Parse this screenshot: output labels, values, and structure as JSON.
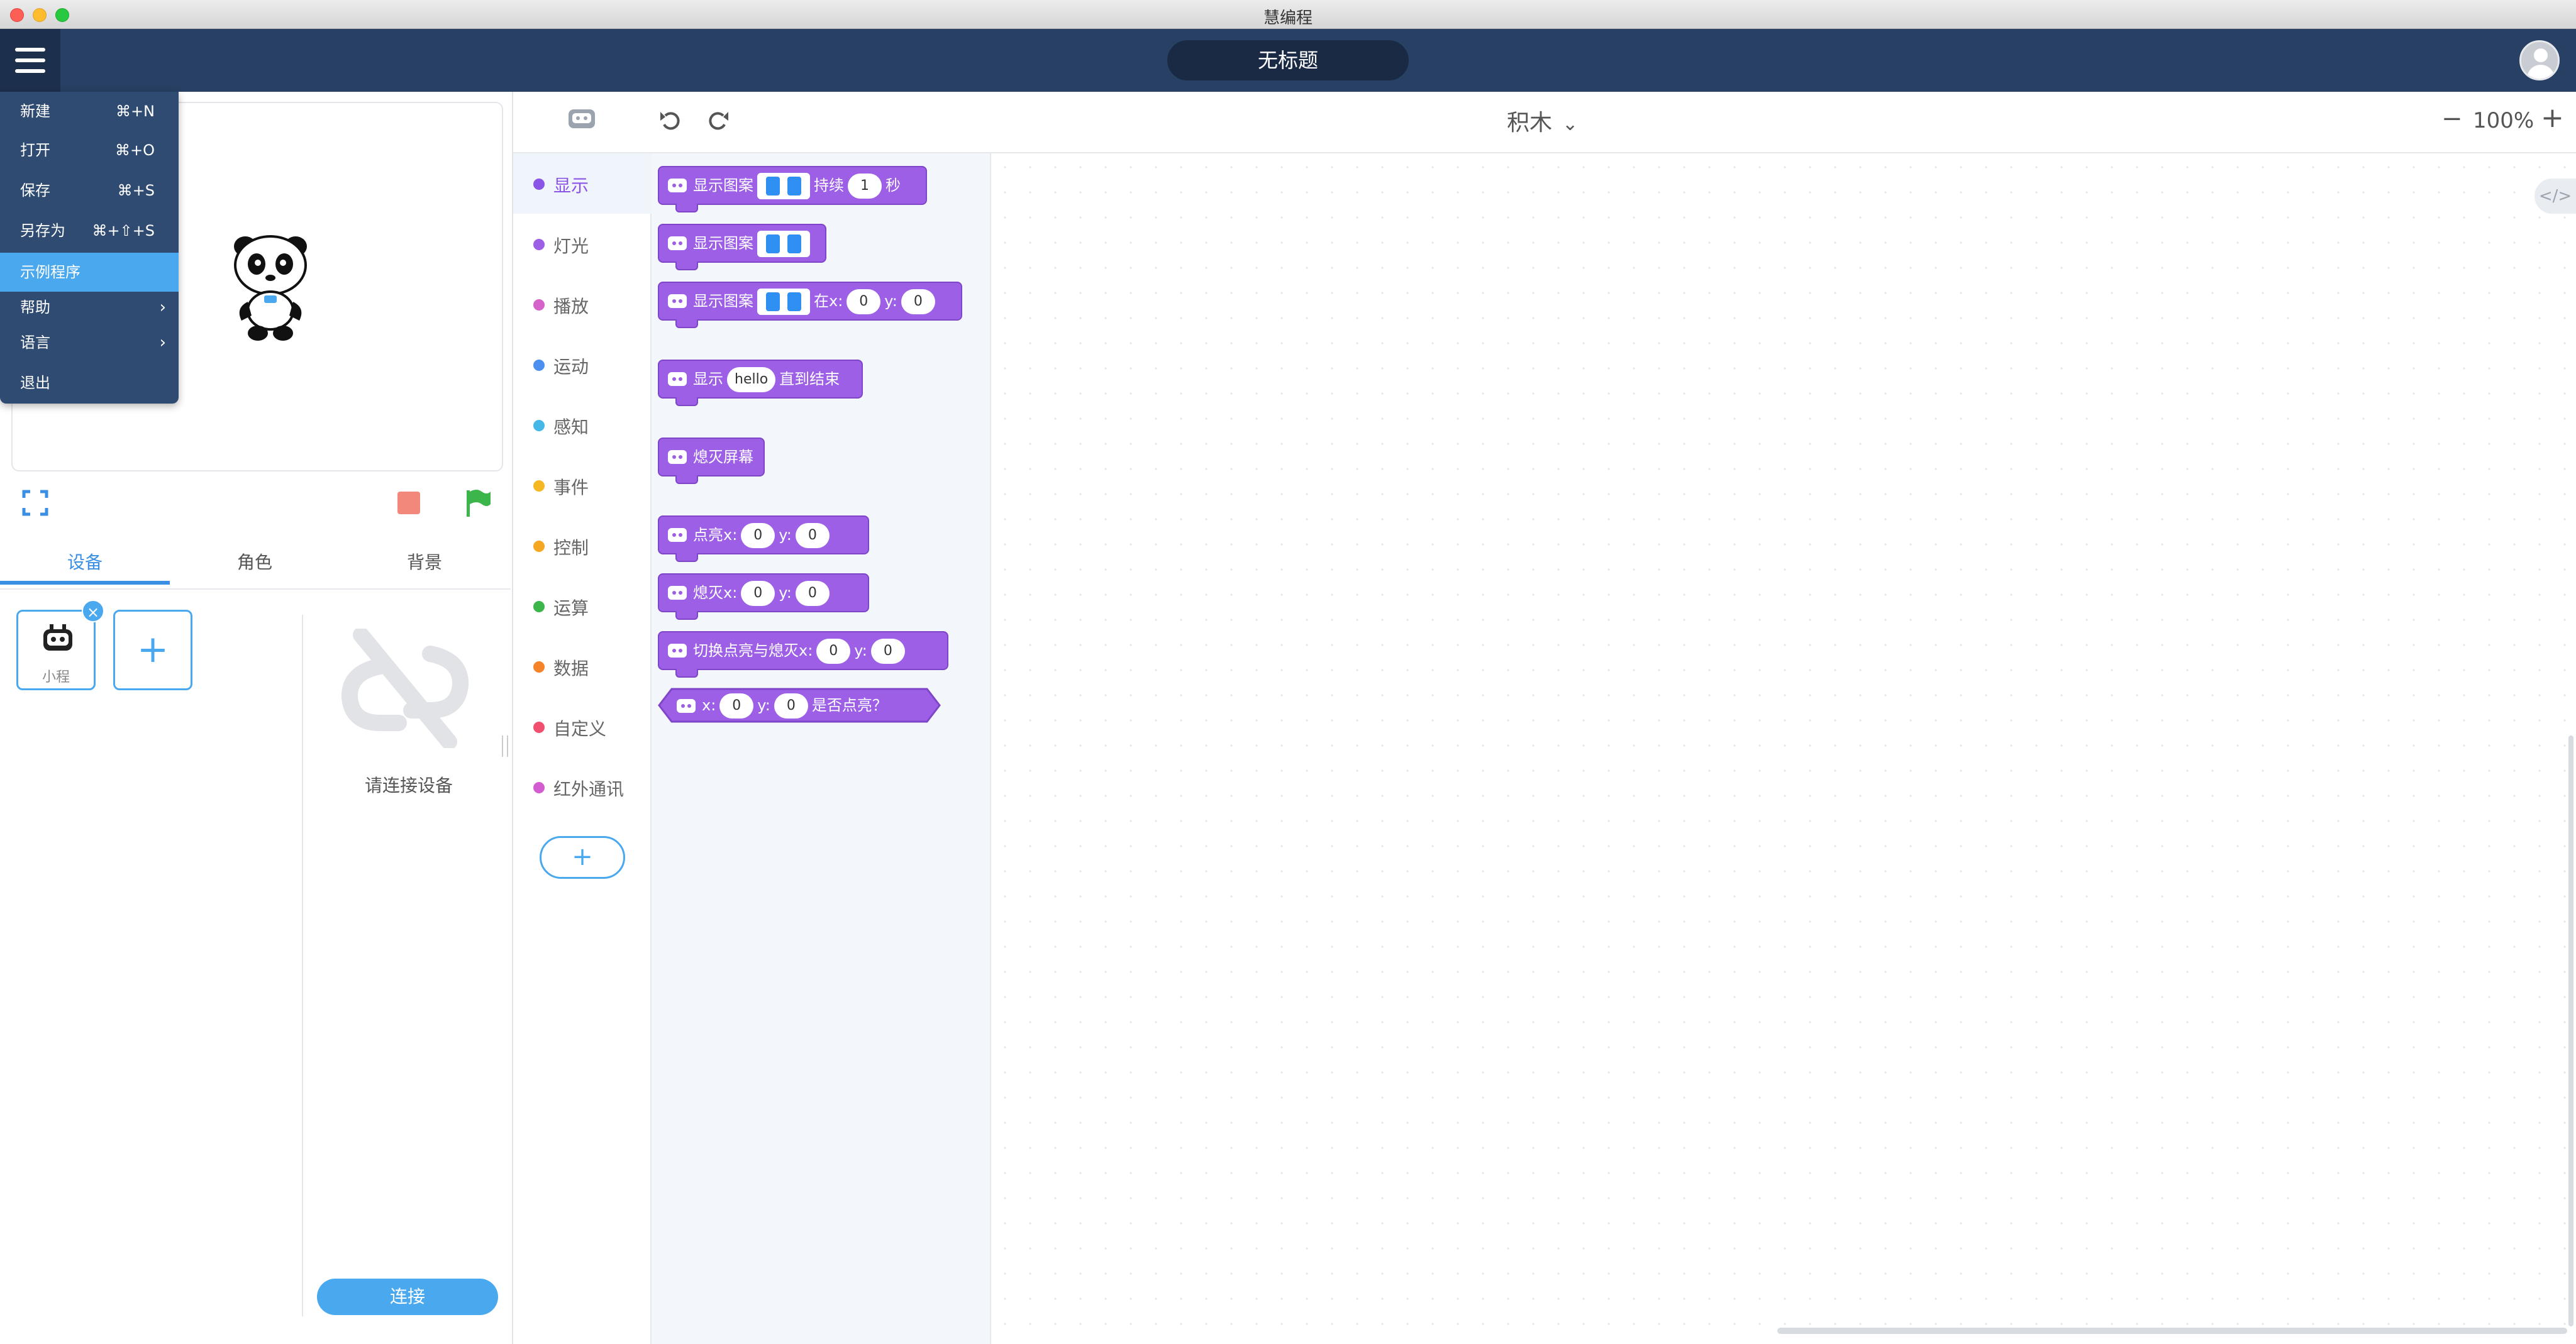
{
  "window": {
    "title": "慧编程"
  },
  "header": {
    "project_title": "无标题"
  },
  "menu": {
    "items": [
      {
        "label": "新建",
        "shortcut": "⌘+N"
      },
      {
        "label": "打开",
        "shortcut": "⌘+O"
      },
      {
        "label": "保存",
        "shortcut": "⌘+S"
      },
      {
        "label": "另存为",
        "shortcut": "⌘+⇧+S"
      },
      {
        "label": "示例程序",
        "shortcut": ""
      },
      {
        "label": "帮助",
        "arrow": "›"
      },
      {
        "label": "语言",
        "arrow": "›"
      },
      {
        "label": "退出",
        "shortcut": ""
      }
    ]
  },
  "left_panel": {
    "tabs": [
      "设备",
      "角色",
      "背景"
    ],
    "device_label": "小程",
    "device_close": "×",
    "add_symbol": "+",
    "connect_hint": "请连接设备",
    "connect_button": "连接"
  },
  "toolbar": {
    "mode": "积木",
    "mode_chevron": "⌄",
    "zoom_out": "−",
    "zoom_level": "100%",
    "zoom_in": "+"
  },
  "categories": {
    "items": [
      {
        "name": "显示",
        "color": "#8a54e6"
      },
      {
        "name": "灯光",
        "color": "#9c5fe6"
      },
      {
        "name": "播放",
        "color": "#d563c9"
      },
      {
        "name": "运动",
        "color": "#4b8ff0"
      },
      {
        "name": "感知",
        "color": "#46b8e8"
      },
      {
        "name": "事件",
        "color": "#f5b823"
      },
      {
        "name": "控制",
        "color": "#f5a623"
      },
      {
        "name": "运算",
        "color": "#3cb54a"
      },
      {
        "name": "数据",
        "color": "#f5832a"
      },
      {
        "name": "自定义",
        "color": "#f0506e"
      },
      {
        "name": "红外通讯",
        "color": "#d35dd0"
      }
    ],
    "add_symbol": "+"
  },
  "blocks": {
    "b1": {
      "t1": "显示图案",
      "t2": "持续",
      "v1": "1",
      "t3": "秒"
    },
    "b2": {
      "t1": "显示图案"
    },
    "b3": {
      "t1": "显示图案",
      "t2": "在x:",
      "v1": "0",
      "t3": "y:",
      "v2": "0"
    },
    "b4": {
      "t1": "显示",
      "v1": "hello",
      "t2": "直到结束"
    },
    "b5": {
      "t1": "熄灭屏幕"
    },
    "b6": {
      "t1": "点亮x:",
      "v1": "0",
      "t2": "y:",
      "v2": "0"
    },
    "b7": {
      "t1": "熄灭x:",
      "v1": "0",
      "t2": "y:",
      "v2": "0"
    },
    "b8": {
      "t1": "切换点亮与熄灭x:",
      "v1": "0",
      "t2": "y:",
      "v2": "0"
    },
    "b9": {
      "t1": "x:",
      "v1": "0",
      "t2": "y:",
      "v2": "0",
      "t3": "是否点亮？"
    }
  },
  "workspace": {
    "code_toggle": "</>"
  },
  "colors": {
    "header": "#274064",
    "accent": "#4aa8ee",
    "block": "#9c5fe6"
  }
}
